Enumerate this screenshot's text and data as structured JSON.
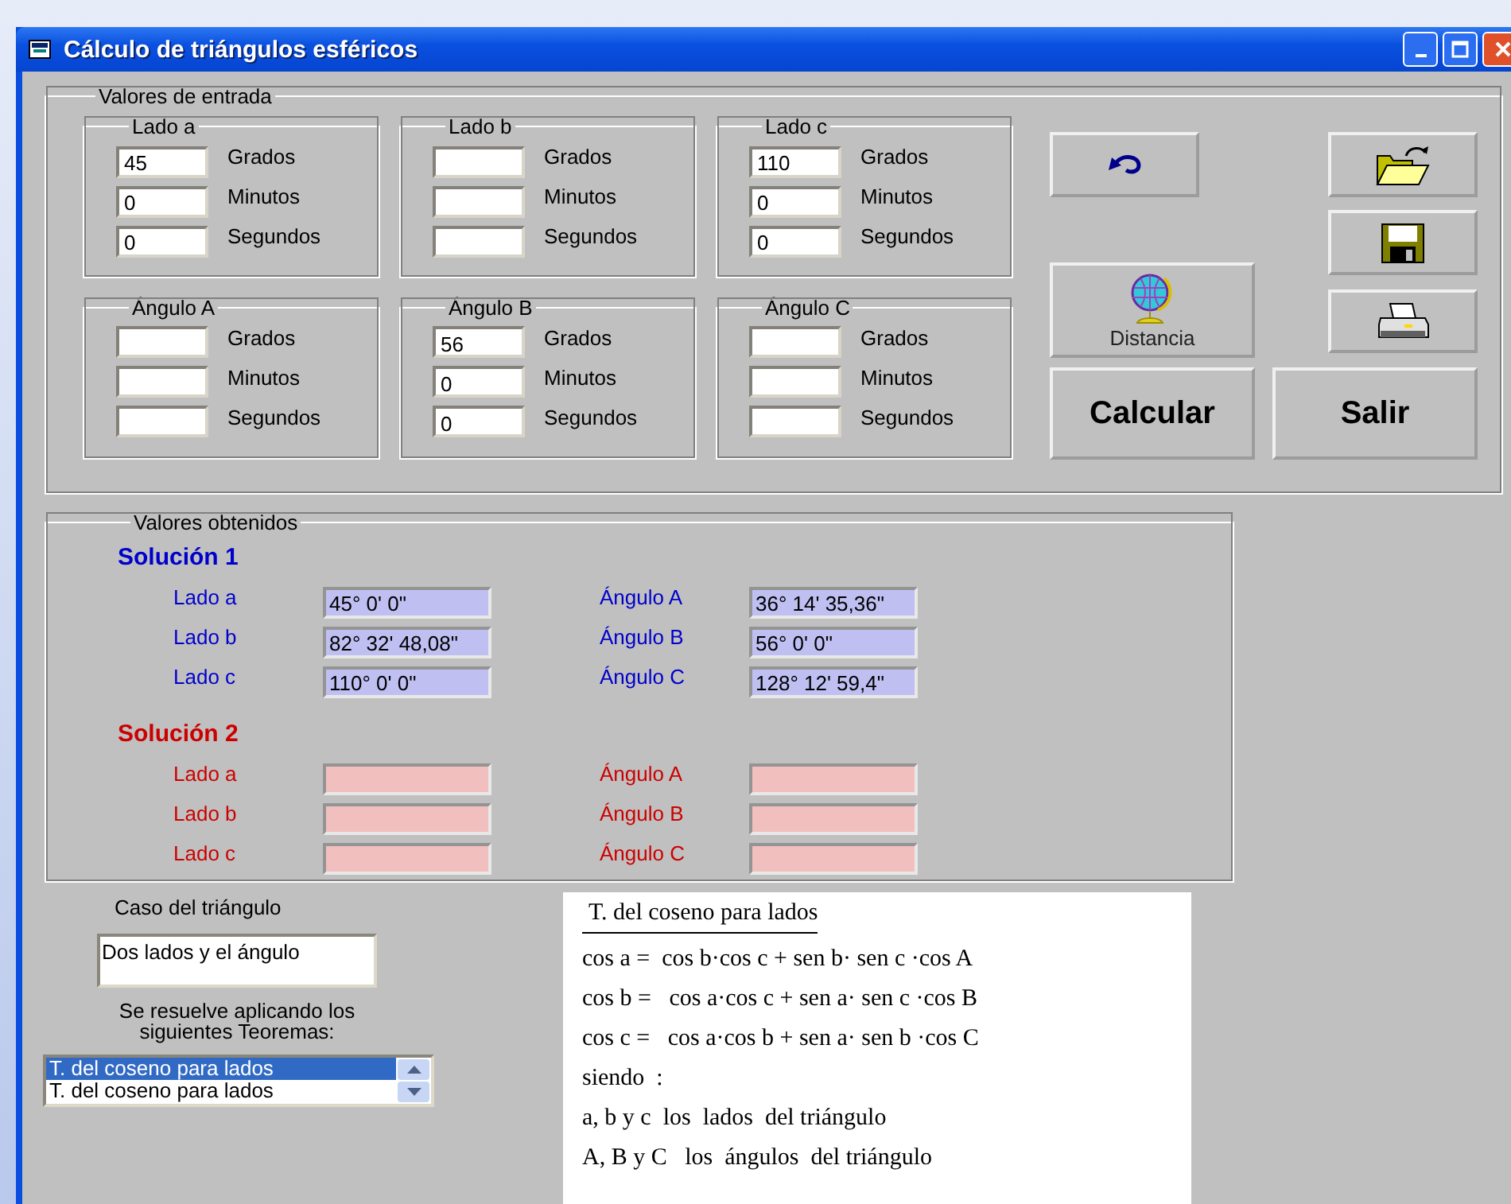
{
  "window": {
    "title": "Cálculo de triángulos esféricos"
  },
  "inputs": {
    "title": "Valores de entrada",
    "groups": [
      {
        "title": "Lado a",
        "fields": [
          {
            "value": "45",
            "label": "Grados"
          },
          {
            "value": "0",
            "label": "Minutos"
          },
          {
            "value": "0",
            "label": "Segundos"
          }
        ]
      },
      {
        "title": "Lado b",
        "fields": [
          {
            "label": "Grados"
          },
          {
            "label": "Minutos"
          },
          {
            "label": "Segundos"
          }
        ]
      },
      {
        "title": "Lado c",
        "fields": [
          {
            "value": "110",
            "label": "Grados"
          },
          {
            "value": "0",
            "label": "Minutos"
          },
          {
            "value": "0",
            "label": "Segundos"
          }
        ]
      },
      {
        "title": "Ángulo A",
        "fields": [
          {
            "label": "Grados"
          },
          {
            "label": "Minutos"
          },
          {
            "label": "Segundos"
          }
        ]
      },
      {
        "title": "Ángulo B",
        "fields": [
          {
            "value": "56",
            "label": "Grados"
          },
          {
            "value": "0",
            "label": "Minutos"
          },
          {
            "value": "0",
            "label": "Segundos"
          }
        ]
      },
      {
        "title": "Ángulo C",
        "fields": [
          {
            "label": "Grados"
          },
          {
            "label": "Minutos"
          },
          {
            "label": "Segundos"
          }
        ]
      }
    ]
  },
  "buttons": [
    {
      "kind": "undo"
    },
    {
      "kind": "open"
    },
    {
      "kind": "save"
    },
    {
      "kind": "distance",
      "label": "Distancia"
    },
    {
      "kind": "print"
    },
    {
      "kind": "calculate",
      "label": "Calcular"
    },
    {
      "kind": "exit",
      "label": "Salir"
    }
  ],
  "results": {
    "title": "Valores obtenidos",
    "solutions": [
      {
        "title": "Solución 1",
        "color": "#0000cc",
        "sides": [
          {
            "label": "Lado a",
            "value": "45° 0' 0\""
          },
          {
            "label": "Lado b",
            "value": "82° 32' 48,08\""
          },
          {
            "label": "Lado c",
            "value": "110° 0' 0\""
          }
        ],
        "angles": [
          {
            "label": "Ángulo A",
            "value": "36° 14' 35,36\""
          },
          {
            "label": "Ángulo B",
            "value": "56° 0' 0\""
          },
          {
            "label": "Ángulo C",
            "value": "128° 12' 59,4\""
          }
        ]
      },
      {
        "title": "Solución 2",
        "color": "#cc0000",
        "sides": [
          {
            "label": "Lado a"
          },
          {
            "label": "Lado b"
          },
          {
            "label": "Lado c"
          }
        ],
        "angles": [
          {
            "label": "Ángulo A"
          },
          {
            "label": "Ángulo B"
          },
          {
            "label": "Ángulo C"
          }
        ]
      }
    ]
  },
  "case": {
    "label": "Caso del triángulo",
    "value": "Dos lados y el ángulo"
  },
  "theorems": {
    "label": "Se resuelve aplicando los siguientes Teoremas:",
    "items": [
      {
        "text": "T. del coseno para lados",
        "selected": true
      },
      {
        "text": "T. del coseno para lados",
        "selected": false
      }
    ]
  },
  "formula": {
    "title": "T. del coseno para  lados",
    "lines": [
      "cos a =  cos b·cos c + sen b· sen c ·cos A",
      "cos b =   cos a·cos c + sen a· sen c ·cos B",
      "cos c =   cos a·cos b + sen a· sen b ·cos C",
      "siendo  :",
      "a, b y c  los  lados  del triángulo",
      "A, B y C   los  ángulos  del triángulo"
    ]
  }
}
